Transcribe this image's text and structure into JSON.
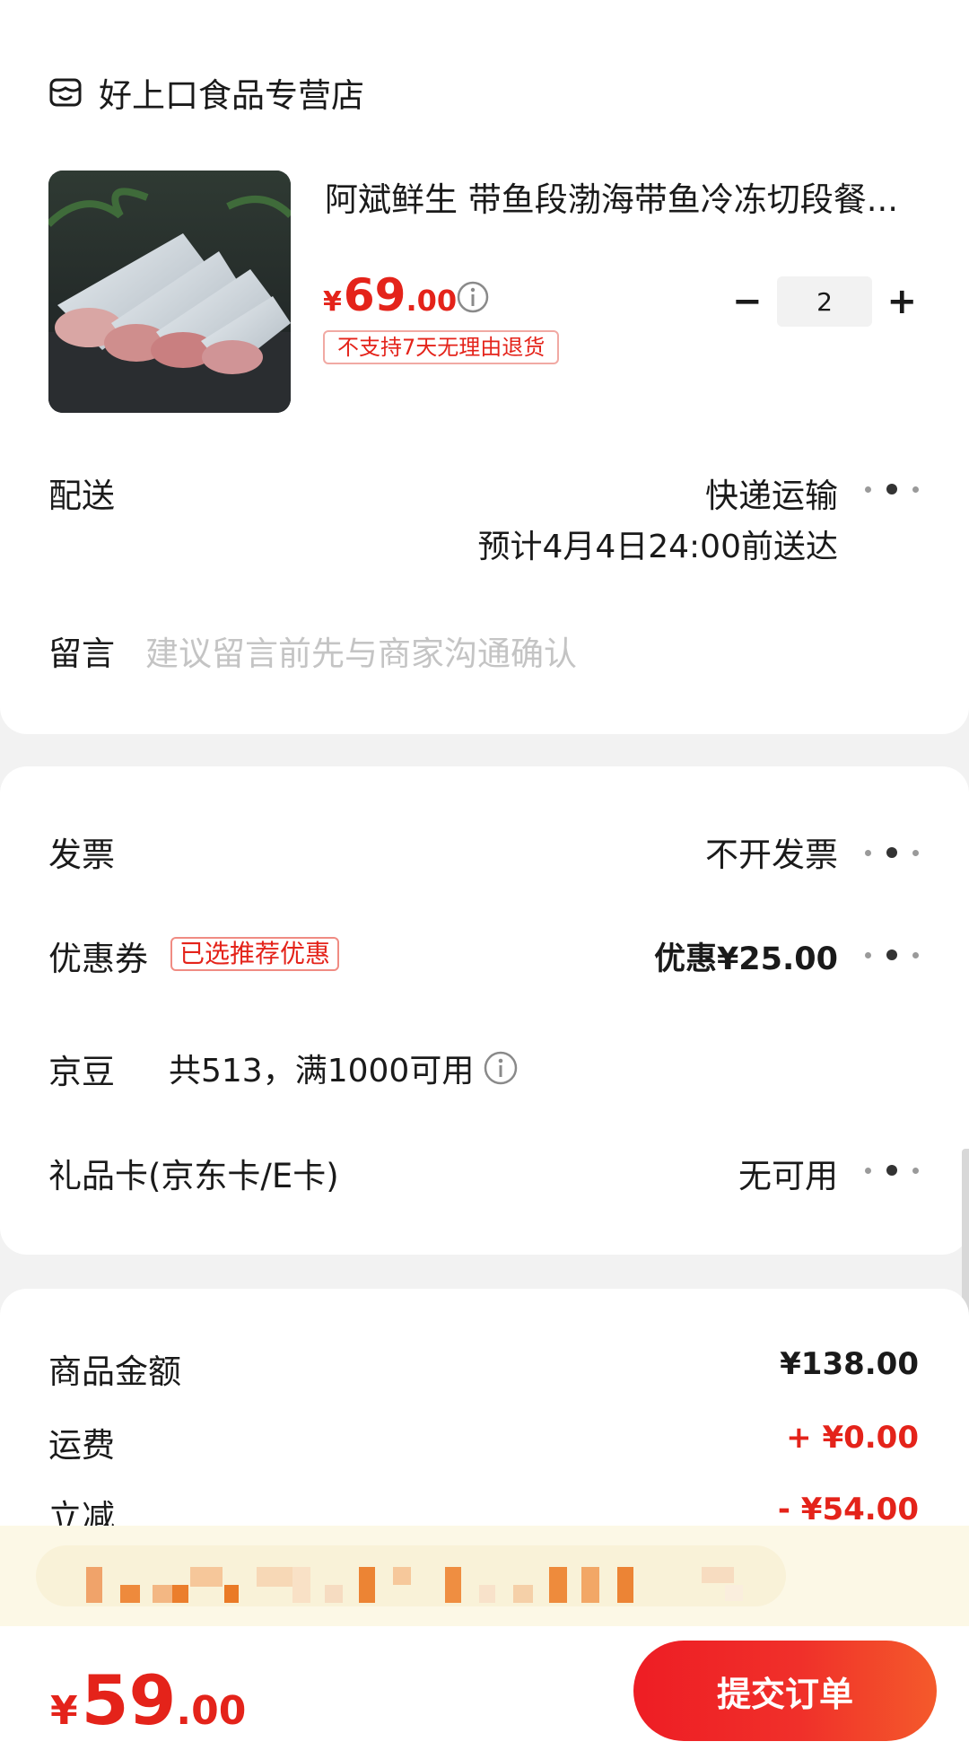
{
  "shop": {
    "name": "好上口食品专营店",
    "icon": "shop-icon"
  },
  "product": {
    "title": "阿斌鲜生 带鱼段渤海带鱼冷冻切段餐...",
    "price_yen": "¥",
    "price_int": "69",
    "price_dec": ".00",
    "return_policy": "不支持7天无理由退货",
    "quantity": "2",
    "minus_label": "−",
    "plus_label": "+"
  },
  "delivery": {
    "label": "配送",
    "method": "快递运输",
    "eta": "预计4月4日24:00前送达"
  },
  "note": {
    "label": "留言",
    "placeholder": "建议留言前先与商家沟通确认"
  },
  "invoice": {
    "label": "发票",
    "value": "不开发票"
  },
  "coupon": {
    "label": "优惠券",
    "badge": "已选推荐优惠",
    "value": "优惠¥25.00"
  },
  "jd_beans": {
    "label": "京豆",
    "text": "共513，满1000可用"
  },
  "gift_card": {
    "label": "礼品卡(京东卡/E卡)",
    "value": "无可用"
  },
  "summary": {
    "goods_label": "商品金额",
    "goods_value": "¥138.00",
    "shipping_label": "运费",
    "shipping_value": "+ ¥0.00",
    "discount_label": "立减",
    "discount_value": "- ¥54.00"
  },
  "footer": {
    "total_yen": "¥",
    "total_int": "59",
    "total_dec": ".00",
    "submit_label": "提交订单"
  },
  "colors": {
    "accent_red": "#e4231a",
    "button_gradient_start": "#ee1d24",
    "button_gradient_end": "#f45a2b",
    "promo_strip_bg": "#fcf8e6"
  }
}
